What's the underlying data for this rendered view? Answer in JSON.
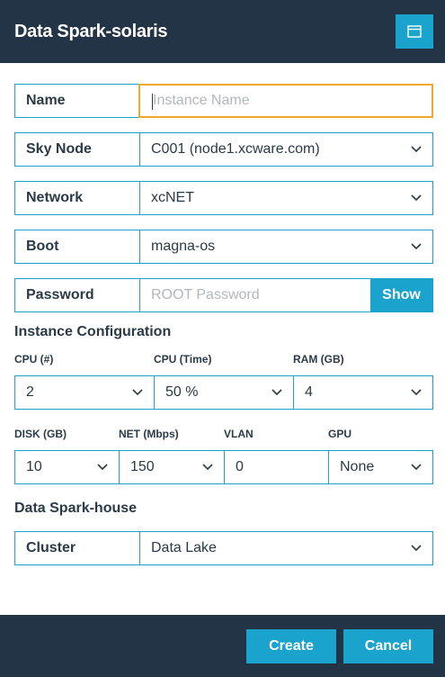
{
  "dialog": {
    "title": "Data Spark-solaris"
  },
  "fields": {
    "name": {
      "label": "Name",
      "value": "",
      "placeholder": "Instance Name"
    },
    "sky_node": {
      "label": "Sky Node",
      "value": "C001 (node1.xcware.com)"
    },
    "network": {
      "label": "Network",
      "value": "xcNET"
    },
    "boot": {
      "label": "Boot",
      "value": "magna-os"
    },
    "password": {
      "label": "Password",
      "value": "",
      "placeholder": "ROOT Password",
      "show_label": "Show"
    }
  },
  "instance_config": {
    "title": "Instance Configuration",
    "cpu_count": {
      "label": "CPU (#)",
      "value": "2"
    },
    "cpu_time": {
      "label": "CPU (Time)",
      "value": "50 %"
    },
    "ram": {
      "label": "RAM (GB)",
      "value": "4"
    },
    "disk": {
      "label": "DISK (GB)",
      "value": "10"
    },
    "net": {
      "label": "NET (Mbps)",
      "value": "150"
    },
    "vlan": {
      "label": "VLAN",
      "value": "0"
    },
    "gpu": {
      "label": "GPU",
      "value": "None"
    }
  },
  "spark_house": {
    "title": "Data Spark-house",
    "cluster": {
      "label": "Cluster",
      "value": "Data Lake"
    }
  },
  "footer": {
    "create_label": "Create",
    "cancel_label": "Cancel"
  },
  "colors": {
    "header_bg": "#243447",
    "accent": "#1aa3cc",
    "focus": "#f0a82a"
  }
}
